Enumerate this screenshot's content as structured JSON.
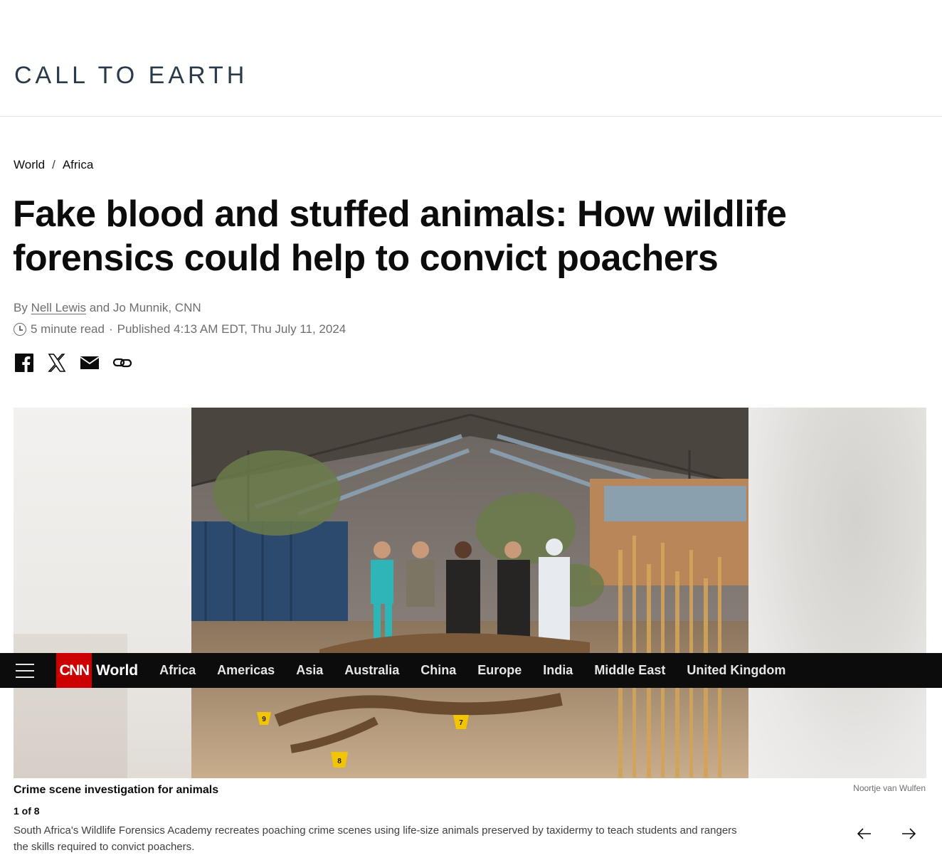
{
  "brand": {
    "title": "CALL TO EARTH"
  },
  "breadcrumb": {
    "items": [
      "World",
      "Africa"
    ],
    "separator": "/"
  },
  "headline": "Fake blood and stuffed animals: How wildlife forensics could help to convict poachers",
  "byline": {
    "prefix": "By",
    "author1": "Nell Lewis",
    "joiner": "and Jo Munnik, CNN"
  },
  "meta": {
    "read_time": "5 minute read",
    "dot": "·",
    "published": "Published 4:13 AM EDT, Thu July 11, 2024"
  },
  "share": {
    "icons": [
      "facebook-icon",
      "x-icon",
      "email-icon",
      "link-icon"
    ]
  },
  "navbar": {
    "logo": "CNN",
    "section": "World",
    "links": [
      "Africa",
      "Americas",
      "Asia",
      "Australia",
      "China",
      "Europe",
      "India",
      "Middle East",
      "United Kingdom"
    ]
  },
  "gallery": {
    "caption_title": "Crime scene investigation for animals",
    "credit": "Noortje van Wulfen",
    "counter": "1 of 8",
    "caption": "South Africa's Wildlife Forensics Academy recreates poaching crime scenes using life-size animals preserved by taxidermy to teach students and rangers the skills required to convict poachers.",
    "evidence_markers": [
      "9",
      "7",
      "8"
    ]
  },
  "colors": {
    "brand_red": "#cc0000",
    "nav_bg": "#0c0c0c",
    "text": "#0c0c0c",
    "muted": "#6e6e6e"
  }
}
